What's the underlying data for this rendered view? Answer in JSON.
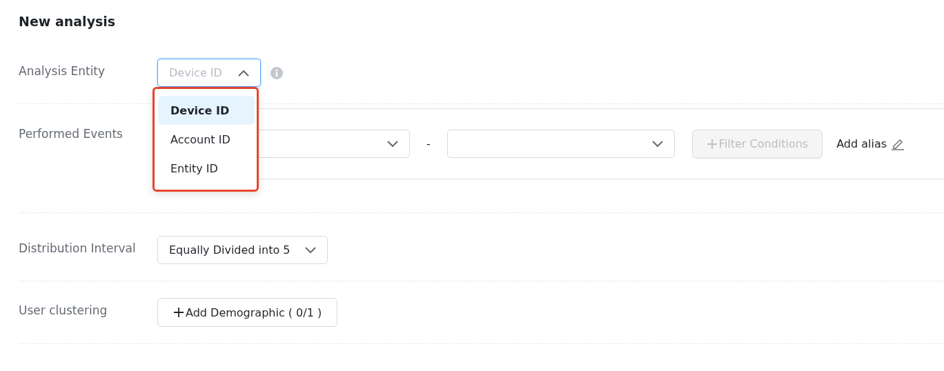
{
  "title": "New analysis",
  "analysis_entity": {
    "label": "Analysis Entity",
    "placeholder": "Device ID",
    "open": true,
    "highlighted": true,
    "options": [
      {
        "label": "Device ID",
        "selected": true
      },
      {
        "label": "Account ID",
        "selected": false
      },
      {
        "label": "Entity ID",
        "selected": false
      }
    ]
  },
  "performed_events": {
    "label": "Performed Events",
    "separator": "-",
    "filter_button": {
      "label": "Filter Conditions",
      "disabled": true
    },
    "alias_link": "Add alias"
  },
  "distribution_interval": {
    "label": "Distribution Interval",
    "value": "Equally Divided into 5"
  },
  "user_clustering": {
    "label": "User clustering",
    "button": "Add Demographic ( 0/1 )"
  }
}
